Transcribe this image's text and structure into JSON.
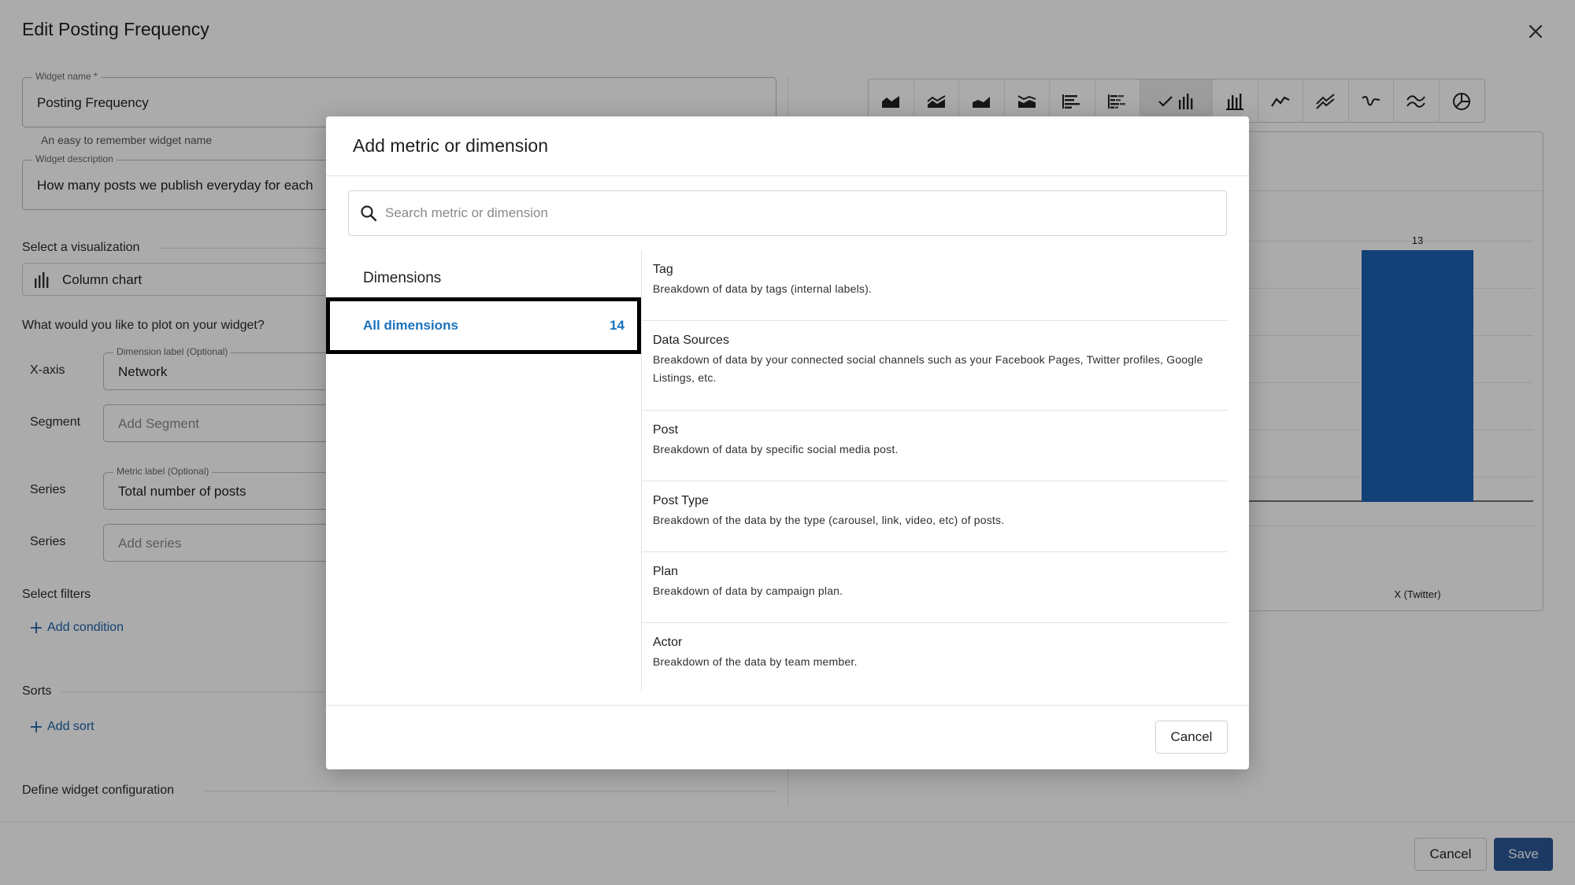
{
  "page": {
    "title": "Edit Posting Frequency",
    "widget_name": {
      "label": "Widget name *",
      "value": "Posting Frequency",
      "helper": "An easy to remember widget name"
    },
    "widget_description": {
      "label": "Widget description",
      "value": "How many posts we publish everyday for each"
    },
    "visualization": {
      "section": "Select a visualization",
      "selected": "Column chart"
    },
    "plot": {
      "section": "What would you like to plot on your widget?",
      "x_axis": {
        "label": "X-axis",
        "field_label": "Dimension label (Optional)",
        "value": "Network"
      },
      "segment": {
        "label": "Segment",
        "placeholder": "Add Segment"
      },
      "series1": {
        "label": "Series",
        "field_label": "Metric label (Optional)",
        "value": "Total number of posts"
      },
      "series2": {
        "label": "Series",
        "placeholder": "Add series"
      }
    },
    "filters": {
      "section": "Select filters",
      "add": "Add condition"
    },
    "sorts": {
      "section": "Sorts",
      "add": "Add sort"
    },
    "config": {
      "section": "Define widget configuration"
    },
    "footer": {
      "cancel": "Cancel",
      "save": "Save"
    }
  },
  "chart_toolbar": {
    "icons": [
      "area-chart-icon",
      "stacked-area-icon",
      "area-chart-icon",
      "stacked-area-icon",
      "bar-chart-icon",
      "stacked-bar-icon",
      "column-chart-icon",
      "stacked-column-icon",
      "line-chart-icon",
      "multi-line-icon",
      "spline-icon",
      "multi-spline-icon",
      "pie-chart-icon"
    ],
    "selected": "column-chart-icon"
  },
  "chart_data": {
    "type": "bar",
    "categories": [
      "X (Twitter)"
    ],
    "values": [
      13
    ],
    "xlabel": "",
    "ylabel": "",
    "grid": true,
    "color": "#1c62b3"
  },
  "modal": {
    "title": "Add metric or dimension",
    "search_placeholder": "Search metric or dimension",
    "dimensions_heading": "Dimensions",
    "all_dimensions": {
      "label": "All dimensions",
      "count": "14"
    },
    "items": [
      {
        "name": "Tag",
        "desc": "Breakdown of data by tags (internal labels)."
      },
      {
        "name": "Data Sources",
        "desc": "Breakdown of data by your connected social channels such as your Facebook Pages, Twitter profiles, Google Listings, etc."
      },
      {
        "name": "Post",
        "desc": "Breakdown of data by specific social media post."
      },
      {
        "name": "Post Type",
        "desc": "Breakdown of the data by the type (carousel, link, video, etc) of posts."
      },
      {
        "name": "Plan",
        "desc": "Breakdown of data by campaign plan."
      },
      {
        "name": "Actor",
        "desc": "Breakdown of the data by team member."
      }
    ],
    "cancel": "Cancel"
  },
  "colors": {
    "accent": "#1c72bd",
    "primary_button": "#2b5796",
    "bar": "#1c62b3"
  }
}
